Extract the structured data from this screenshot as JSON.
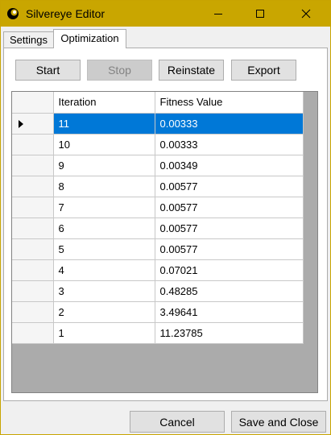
{
  "window": {
    "title": "Silvereye Editor"
  },
  "tabs": [
    {
      "label": "Settings",
      "active": false
    },
    {
      "label": "Optimization",
      "active": true
    }
  ],
  "toolbar": {
    "start_label": "Start",
    "stop_label": "Stop",
    "reinstate_label": "Reinstate",
    "export_label": "Export"
  },
  "grid": {
    "columns": [
      "Iteration",
      "Fitness Value"
    ],
    "rows": [
      {
        "iteration": "11",
        "fitness": "0.00333",
        "selected": true
      },
      {
        "iteration": "10",
        "fitness": "0.00333"
      },
      {
        "iteration": "9",
        "fitness": "0.00349"
      },
      {
        "iteration": "8",
        "fitness": "0.00577"
      },
      {
        "iteration": "7",
        "fitness": "0.00577"
      },
      {
        "iteration": "6",
        "fitness": "0.00577"
      },
      {
        "iteration": "5",
        "fitness": "0.00577"
      },
      {
        "iteration": "4",
        "fitness": "0.07021"
      },
      {
        "iteration": "3",
        "fitness": "0.48285"
      },
      {
        "iteration": "2",
        "fitness": "3.49641"
      },
      {
        "iteration": "1",
        "fitness": "11.23785"
      }
    ]
  },
  "footer": {
    "cancel_label": "Cancel",
    "save_close_label": "Save and Close"
  },
  "colors": {
    "titlebar": "#c9a600",
    "selection": "#0078d7",
    "grid_background": "#ababab"
  },
  "icons": {
    "app": "eye-icon",
    "minimize": "minimize-icon",
    "maximize": "maximize-icon",
    "close": "close-icon",
    "row_pointer": "row-pointer-icon"
  }
}
